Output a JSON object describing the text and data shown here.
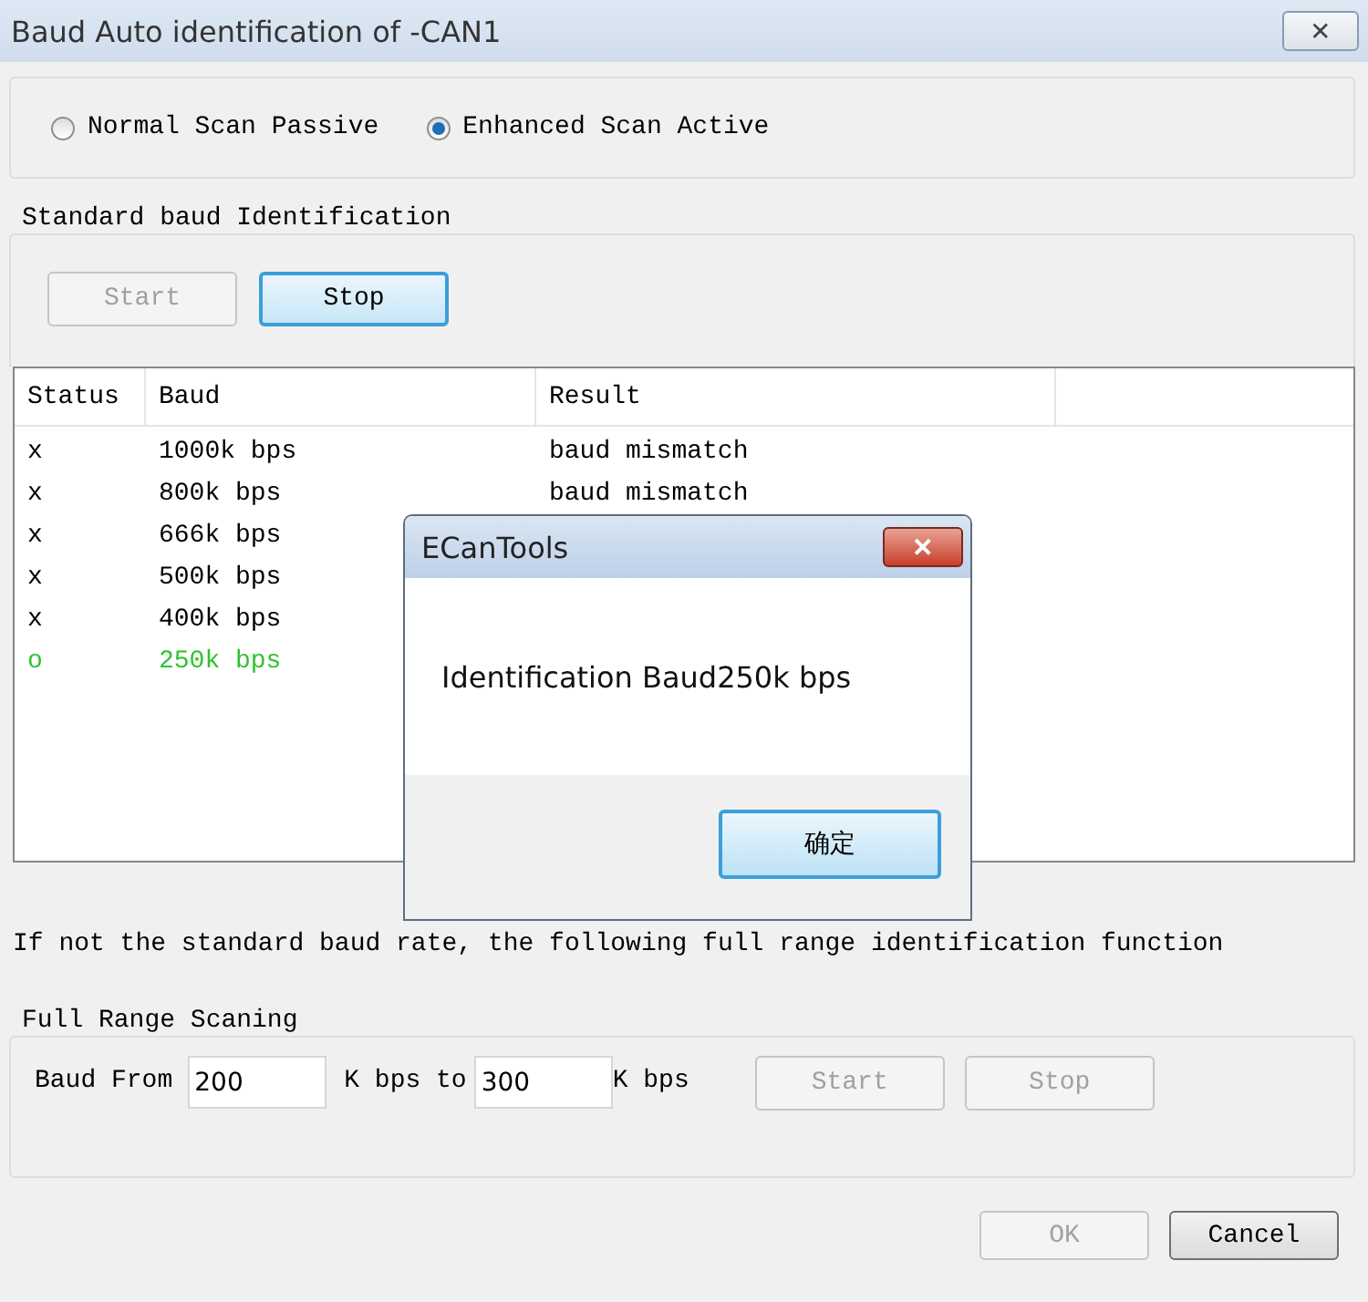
{
  "window": {
    "title": "Baud Auto identification of -CAN1",
    "close": "✕"
  },
  "scan_modes": [
    {
      "label": "Normal Scan Passive",
      "selected": false
    },
    {
      "label": "Enhanced Scan Active",
      "selected": true
    }
  ],
  "standard": {
    "title": "Standard baud Identification",
    "buttons": [
      {
        "label": "Start",
        "disabled": true,
        "focused": false
      },
      {
        "label": "Stop",
        "disabled": false,
        "focused": true
      }
    ],
    "table": {
      "columns": [
        "Status",
        "Baud",
        "Result"
      ],
      "rows": [
        {
          "status": "x",
          "baud": "1000k bps",
          "result": "baud mismatch",
          "matched": false
        },
        {
          "status": "x",
          "baud": "800k bps",
          "result": "baud mismatch",
          "matched": false
        },
        {
          "status": "x",
          "baud": "666k bps",
          "matched": false
        },
        {
          "status": "x",
          "baud": "500k bps",
          "matched": false
        },
        {
          "status": "x",
          "baud": "400k bps",
          "matched": false
        },
        {
          "status": "o",
          "baud": "250k bps",
          "matched": true
        }
      ]
    }
  },
  "note": "If not the standard baud rate, the following full range identification function",
  "full_range": {
    "title": "Full Range Scaning",
    "from_label": "Baud From",
    "from": "200",
    "to_label": "K bps to",
    "to": "300",
    "unit": "K bps",
    "buttons": [
      {
        "label": "Start",
        "disabled": true,
        "focused": false
      },
      {
        "label": "Stop",
        "disabled": true,
        "focused": false
      }
    ]
  },
  "footer_buttons": [
    {
      "label": "OK",
      "disabled": true,
      "focused": false
    },
    {
      "label": "Cancel",
      "disabled": false,
      "focused": false
    }
  ],
  "message_box": {
    "title": "ECanTools",
    "close": "✕",
    "message": "Identification Baud250k bps",
    "button": "确定"
  }
}
